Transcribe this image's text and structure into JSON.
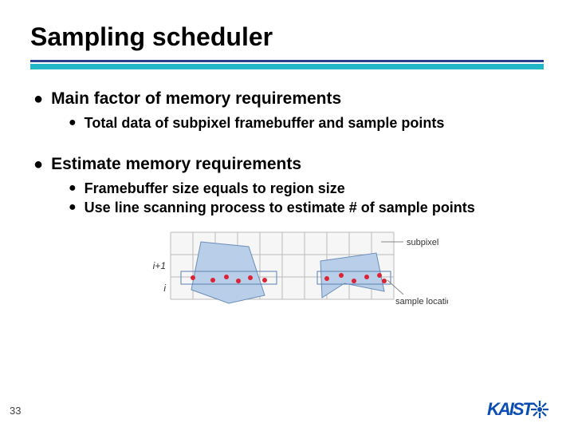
{
  "title": "Sampling scheduler",
  "bullets": {
    "b1a": "Main factor of memory requirements",
    "b1a_sub1": "Total data of subpixel framebuffer and sample points",
    "b1b": "Estimate memory requirements",
    "b1b_sub1": "Framebuffer size equals to region size",
    "b1b_sub2": "Use line scanning process to estimate # of sample points"
  },
  "diagram": {
    "rowlabel_top": "i+1",
    "rowlabel_bottom": "i",
    "label_subpixel": "subpixel",
    "label_samplelocation": "sample location"
  },
  "pagenum": "33",
  "logo_text": "KAIST"
}
